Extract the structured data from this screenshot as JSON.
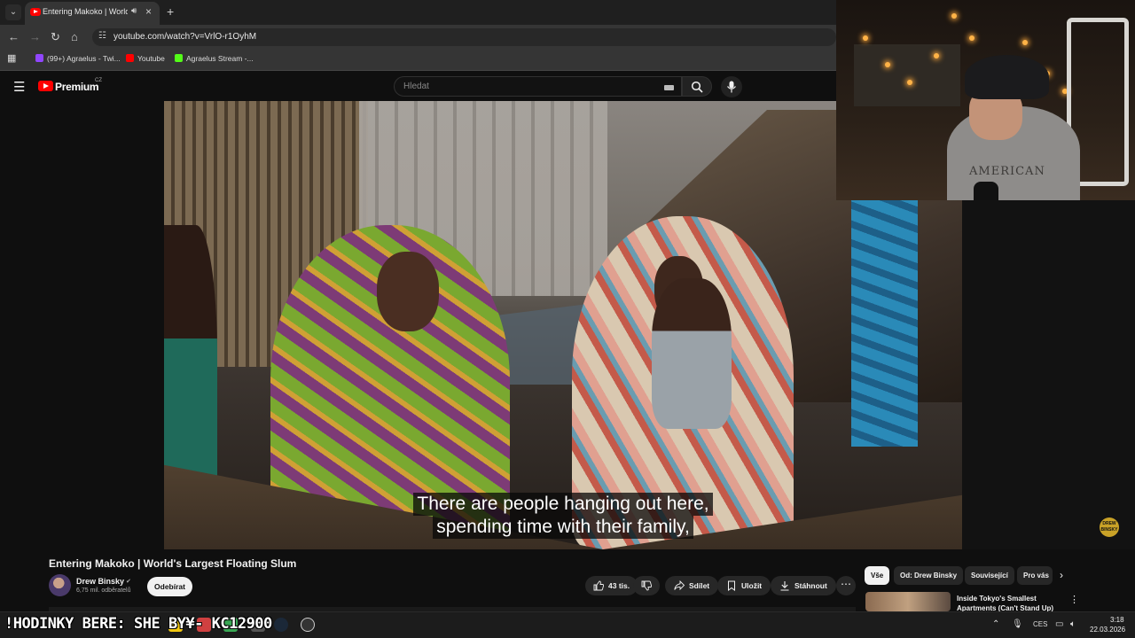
{
  "browser": {
    "tab": {
      "title": "Entering Makoko | World's Largest Floating Slum"
    },
    "url": "youtube.com/watch?v=VrlO-r1OyhM",
    "bookmarks": [
      {
        "label": "(99+) Agraelus - Twi...",
        "color": "#9146ff"
      },
      {
        "label": "Youtube",
        "color": "#ff0000"
      },
      {
        "label": "Agraelus Stream -...",
        "color": "#53fc18"
      }
    ]
  },
  "youtube": {
    "brand": "Premium",
    "region": "CZ",
    "search": {
      "placeholder": "Hledat"
    }
  },
  "video": {
    "subtitle": [
      "There are people hanging out here,",
      "spending time with their family,"
    ],
    "title": "Entering Makoko | World's Largest Floating Slum"
  },
  "channel": {
    "name": "Drew Binsky",
    "verified": "✔",
    "subscribers": "6,75 mil. odběratelů",
    "subscribe_label": "Odebírat"
  },
  "actions": {
    "likes": "43 tis.",
    "share": "Sdílet",
    "save": "Uložit",
    "download": "Stáhnout",
    "more": "⋯"
  },
  "sidebar": {
    "chips": [
      "Vše",
      "Od: Drew Binsky",
      "Související",
      "Pro vás"
    ],
    "recommended": {
      "title": "Inside Tokyo's Smallest Apartments (Can't Stand Up)"
    }
  },
  "webcam": {
    "shirt_text": "AMERICAN"
  },
  "badge": {
    "text": "DREW BINSKY"
  },
  "stream": {
    "ticker": "!HODINKY BERE: SHE  BY¥- KC12900"
  },
  "taskbar": {
    "lang": "CES",
    "time": "3:18",
    "date": "22.03.2026"
  },
  "colors": {
    "accent": "#ff0000",
    "bg": "#0f0f0f",
    "pill": "#272727"
  }
}
